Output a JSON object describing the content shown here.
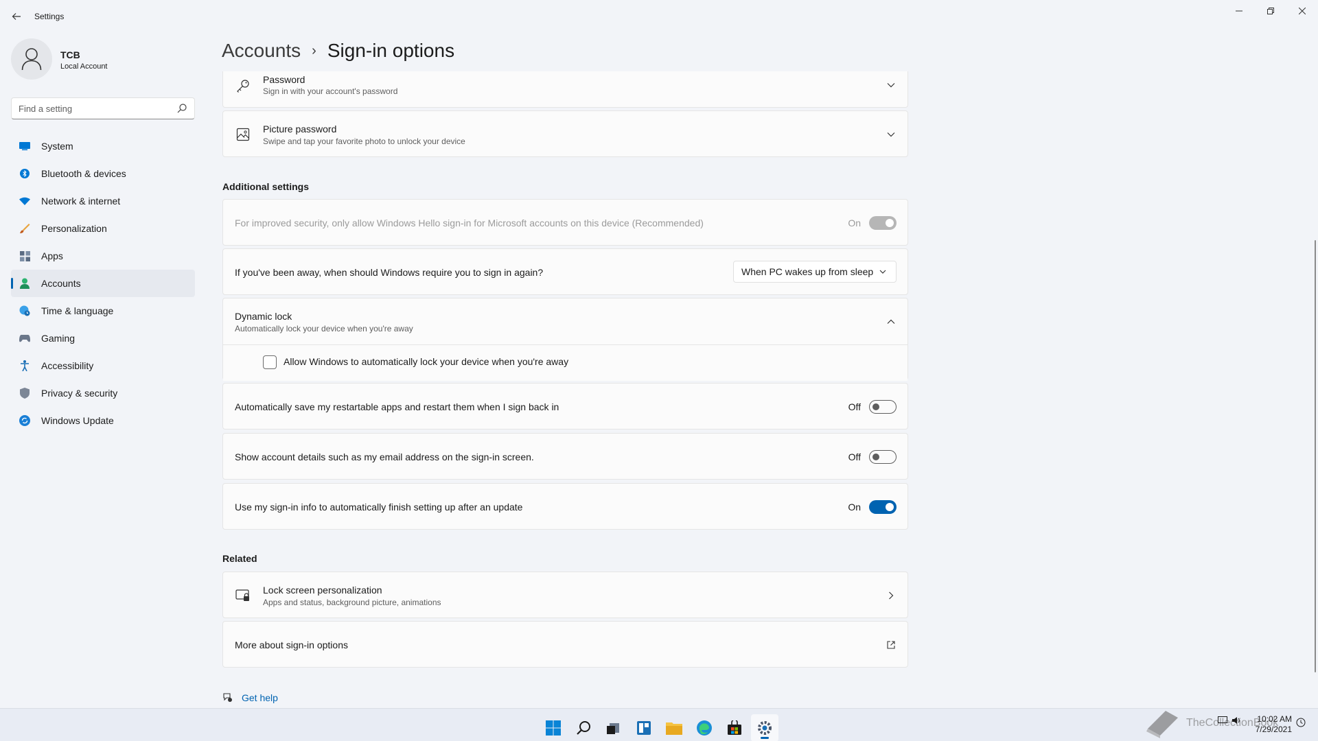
{
  "app": {
    "title": "Settings"
  },
  "profile": {
    "name": "TCB",
    "account_type": "Local Account"
  },
  "search": {
    "placeholder": "Find a setting"
  },
  "nav": {
    "items": [
      {
        "label": "System",
        "icon": "monitor-icon",
        "active": false
      },
      {
        "label": "Bluetooth & devices",
        "icon": "bluetooth-icon",
        "active": false
      },
      {
        "label": "Network & internet",
        "icon": "wifi-icon",
        "active": false
      },
      {
        "label": "Personalization",
        "icon": "brush-icon",
        "active": false
      },
      {
        "label": "Apps",
        "icon": "apps-icon",
        "active": false
      },
      {
        "label": "Accounts",
        "icon": "person-icon",
        "active": true
      },
      {
        "label": "Time & language",
        "icon": "globe-clock-icon",
        "active": false
      },
      {
        "label": "Gaming",
        "icon": "gamepad-icon",
        "active": false
      },
      {
        "label": "Accessibility",
        "icon": "accessibility-icon",
        "active": false
      },
      {
        "label": "Privacy & security",
        "icon": "shield-icon",
        "active": false
      },
      {
        "label": "Windows Update",
        "icon": "update-icon",
        "active": false
      }
    ]
  },
  "breadcrumb": {
    "parent": "Accounts",
    "separator": "›",
    "current": "Sign-in options"
  },
  "sign_in_methods": {
    "password": {
      "title": "Password",
      "subtitle": "Sign in with your account's password"
    },
    "picture_password": {
      "title": "Picture password",
      "subtitle": "Swipe and tap your favorite photo to unlock your device"
    }
  },
  "additional": {
    "heading": "Additional settings",
    "hello_only": {
      "label": "For improved security, only allow Windows Hello sign-in for Microsoft accounts on this device (Recommended)",
      "state": "On",
      "enabled": false
    },
    "require_signin": {
      "label": "If you've been away, when should Windows require you to sign in again?",
      "selected": "When PC wakes up from sleep"
    },
    "dynamic_lock": {
      "title": "Dynamic lock",
      "subtitle": "Automatically lock your device when you're away",
      "expanded": true,
      "checkbox_label": "Allow Windows to automatically lock your device when you're away",
      "checked": false
    },
    "restart_apps": {
      "label": "Automatically save my restartable apps and restart them when I sign back in",
      "state": "Off"
    },
    "show_account_details": {
      "label": "Show account details such as my email address on the sign-in screen.",
      "state": "Off"
    },
    "use_signin_info": {
      "label": "Use my sign-in info to automatically finish setting up after an update",
      "state": "On"
    }
  },
  "related": {
    "heading": "Related",
    "lock_screen": {
      "title": "Lock screen personalization",
      "subtitle": "Apps and status, background picture, animations"
    },
    "more_about": {
      "label": "More about sign-in options"
    }
  },
  "help": {
    "label": "Get help"
  },
  "taskbar": {
    "icons": [
      "windows-start-icon",
      "search-icon",
      "task-view-icon",
      "widgets-icon",
      "file-explorer-icon",
      "edge-icon",
      "store-icon",
      "settings-icon"
    ],
    "active": "settings-icon",
    "time": "10:02 AM",
    "date": "7/29/2021",
    "watermark": "TheCollectionBook"
  },
  "colors": {
    "accent": "#0063b1",
    "background": "#f2f4f8",
    "card": "#fbfbfb"
  }
}
